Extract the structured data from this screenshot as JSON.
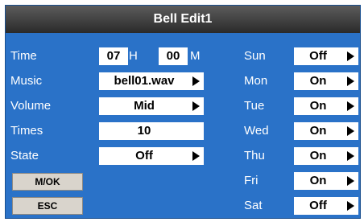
{
  "window": {
    "title": "Bell Edit1"
  },
  "time": {
    "label": "Time",
    "hour": "07",
    "hour_unit": "H",
    "minute": "00",
    "minute_unit": "M"
  },
  "music": {
    "label": "Music",
    "value": "bell01.wav"
  },
  "volume": {
    "label": "Volume",
    "value": "Mid"
  },
  "times": {
    "label": "Times",
    "value": "10"
  },
  "state": {
    "label": "State",
    "value": "Off"
  },
  "buttons": {
    "ok": "M/OK",
    "esc": "ESC"
  },
  "days": [
    {
      "label": "Sun",
      "value": "Off"
    },
    {
      "label": "Mon",
      "value": "On"
    },
    {
      "label": "Tue",
      "value": "On"
    },
    {
      "label": "Wed",
      "value": "On"
    },
    {
      "label": "Thu",
      "value": "On"
    },
    {
      "label": "Fri",
      "value": "On"
    },
    {
      "label": "Sat",
      "value": "Off"
    }
  ],
  "colors": {
    "panel": "#2a72c8",
    "titlebar": "#3a3a3a",
    "button": "#d9d4cc"
  },
  "icons": {
    "dropdown": "triangle-right-icon"
  }
}
